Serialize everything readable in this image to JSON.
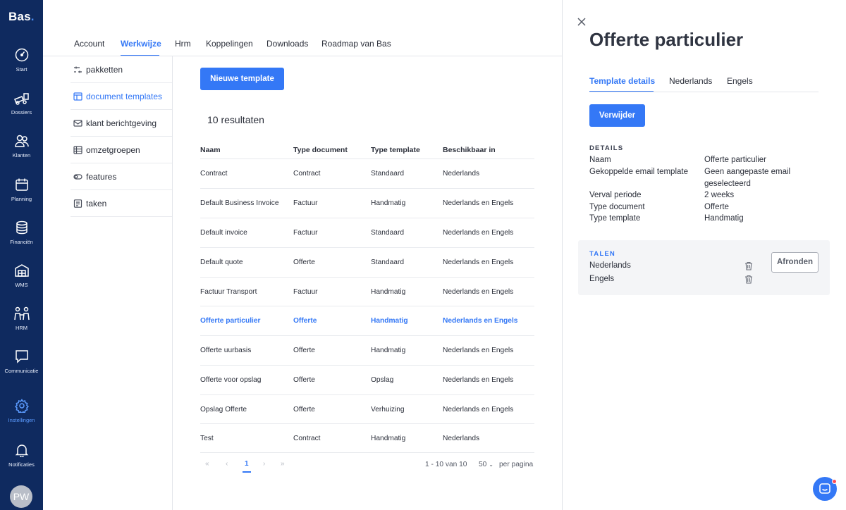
{
  "app": {
    "logo": "Bas",
    "logo_dot": "."
  },
  "rail": {
    "items": [
      {
        "label": "Start",
        "icon": "gauge-icon"
      },
      {
        "label": "Dossiers",
        "icon": "dossiers-icon"
      },
      {
        "label": "Klanten",
        "icon": "users-icon"
      },
      {
        "label": "Planning",
        "icon": "calendar-icon"
      },
      {
        "label": "Financiën",
        "icon": "coins-icon"
      },
      {
        "label": "WMS",
        "icon": "warehouse-icon"
      },
      {
        "label": "HRM",
        "icon": "people-icon"
      },
      {
        "label": "Communicatie",
        "icon": "chat-icon"
      },
      {
        "label": "Instellingen",
        "icon": "gear-icon"
      },
      {
        "label": "Notificaties",
        "icon": "bell-icon"
      }
    ],
    "active": "Instellingen",
    "avatar": "PW"
  },
  "tabs": [
    "Account",
    "Werkwijze",
    "Hrm",
    "Koppelingen",
    "Downloads",
    "Roadmap van Bas"
  ],
  "active_tab": "Werkwijze",
  "subnav": [
    "pakketten",
    "document templates",
    "klant berichtgeving",
    "omzetgroepen",
    "features",
    "taken"
  ],
  "active_subnav": "document templates",
  "main": {
    "new_button": "Nieuwe template",
    "results": "10 resultaten",
    "columns": [
      "Naam",
      "Type document",
      "Type template",
      "Beschikbaar in"
    ],
    "rows": [
      [
        "Contract",
        "Contract",
        "Standaard",
        "Nederlands"
      ],
      [
        "Default Business Invoice",
        "Factuur",
        "Handmatig",
        "Nederlands en Engels"
      ],
      [
        "Default invoice",
        "Factuur",
        "Standaard",
        "Nederlands en Engels"
      ],
      [
        "Default quote",
        "Offerte",
        "Standaard",
        "Nederlands en Engels"
      ],
      [
        "Factuur Transport",
        "Factuur",
        "Handmatig",
        "Nederlands en Engels"
      ],
      [
        "Offerte particulier",
        "Offerte",
        "Handmatig",
        "Nederlands en Engels"
      ],
      [
        "Offerte uurbasis",
        "Offerte",
        "Handmatig",
        "Nederlands en Engels"
      ],
      [
        "Offerte voor opslag",
        "Offerte",
        "Opslag",
        "Nederlands en Engels"
      ],
      [
        "Opslag Offerte",
        "Offerte",
        "Verhuizing",
        "Nederlands en Engels"
      ],
      [
        "Test",
        "Contract",
        "Handmatig",
        "Nederlands"
      ]
    ],
    "active_row": 5,
    "pagination": {
      "first": "«",
      "prev": "‹",
      "page": "1",
      "next": "›",
      "last": "»",
      "range": "1 - 10 van 10",
      "per_page_value": "50",
      "per_page_label": "per pagina"
    }
  },
  "panel": {
    "title": "Offerte particulier",
    "tabs": [
      "Template details",
      "Nederlands",
      "Engels"
    ],
    "active_tab": "Template details",
    "delete_button": "Verwijder",
    "details_heading": "DETAILS",
    "details": [
      {
        "label": "Naam",
        "value": "Offerte particulier"
      },
      {
        "label": "Gekoppelde email template",
        "value": "Geen aangepaste email geselecteerd"
      },
      {
        "label": "Verval periode",
        "value": "2 weeks"
      },
      {
        "label": "Type document",
        "value": "Offerte"
      },
      {
        "label": "Type template",
        "value": "Handmatig"
      }
    ],
    "talen_heading": "TALEN",
    "talen": [
      "Nederlands",
      "Engels"
    ],
    "finish_button": "Afronden"
  },
  "colors": {
    "rail": "#0f2a5f",
    "accent": "#3478f6",
    "text": "#2b2f3a"
  }
}
